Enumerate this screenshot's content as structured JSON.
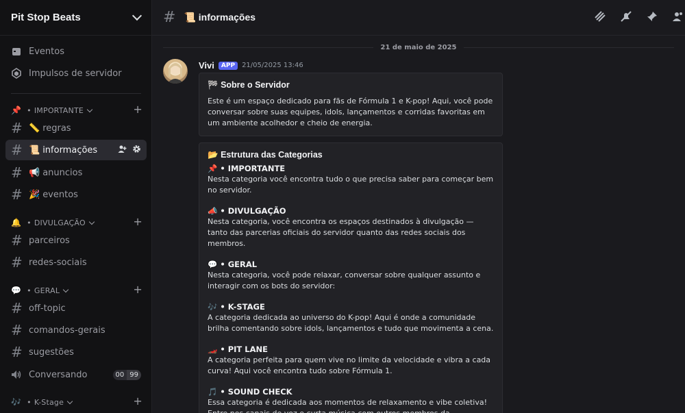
{
  "server": {
    "name": "Pit Stop Beats"
  },
  "top_items": [
    {
      "label": "Eventos",
      "icon": "calendar-icon"
    },
    {
      "label": "Impulsos de servidor",
      "icon": "boost-icon"
    }
  ],
  "categories": [
    {
      "emoji": "📌",
      "name": "IMPORTANTE"
    },
    {
      "emoji": "🔔",
      "name": "DIVULGAÇÃO"
    },
    {
      "emoji": "💬",
      "name": "GERAL"
    },
    {
      "emoji": "🎶",
      "name": "K-Stage"
    }
  ],
  "channels": [
    {
      "emoji": "📏",
      "name": "regras"
    },
    {
      "emoji": "📜",
      "name": "informações"
    },
    {
      "emoji": "📢",
      "name": "anuncios"
    },
    {
      "emoji": "🎉",
      "name": "eventos"
    },
    {
      "emoji": "",
      "name": "parceiros"
    },
    {
      "emoji": "",
      "name": "redes-sociais"
    },
    {
      "emoji": "",
      "name": "off-topic"
    },
    {
      "emoji": "",
      "name": "comandos-gerais"
    },
    {
      "emoji": "",
      "name": "sugestões"
    }
  ],
  "voice": {
    "name": "Conversando",
    "count_a": "00",
    "count_b": "99"
  },
  "header": {
    "channel_emoji": "📜",
    "channel_name": "informações"
  },
  "date_separator": "21 de maio de 2025",
  "message": {
    "author": "Vivi",
    "badge": "APP",
    "timestamp": "21/05/2025 13:46"
  },
  "embed1": {
    "emoji": "🏁",
    "title": "Sobre o Servidor",
    "description": "Este é um espaço dedicado para fãs de Fórmula 1 e K-pop! Aqui, você pode conversar sobre suas equipes, idols, lançamentos e corridas favoritas em um ambiente acolhedor e cheio de energia."
  },
  "embed2": {
    "emoji": "📂",
    "title": "Estrutura das Categorias",
    "sections": [
      {
        "emoji": "📌",
        "title": "• IMPORTANTE",
        "body": "Nesta categoria você encontra tudo o que precisa saber para começar bem no servidor."
      },
      {
        "emoji": "📣",
        "title": "• DIVULGAÇÃO",
        "body": "Nesta categoria, você encontra os espaços destinados à divulgação — tanto das parcerias oficiais do servidor quanto das redes sociais dos membros."
      },
      {
        "emoji": "💬",
        "title": "• GERAL",
        "body": "Nesta categoria, você pode relaxar, conversar sobre qualquer assunto e interagir com os bots do servidor:"
      },
      {
        "emoji": "🎶",
        "title": "• K-STAGE",
        "body": "A categoria dedicada ao universo do K-pop! Aqui é onde a comunidade brilha comentando sobre idols, lançamentos e tudo que movimenta a cena."
      },
      {
        "emoji": "🏎️",
        "title": "• PIT LANE",
        "body": "A categoria perfeita para quem vive no limite da velocidade e vibra a cada curva! Aqui você encontra tudo sobre Fórmula 1."
      },
      {
        "emoji": "🎵",
        "title": "• SOUND CHECK",
        "body": "Essa categoria é dedicada aos momentos de relaxamento e vibe coletiva! Entre nos canais de voz e curta música com outros membros da comunidade:"
      }
    ]
  }
}
